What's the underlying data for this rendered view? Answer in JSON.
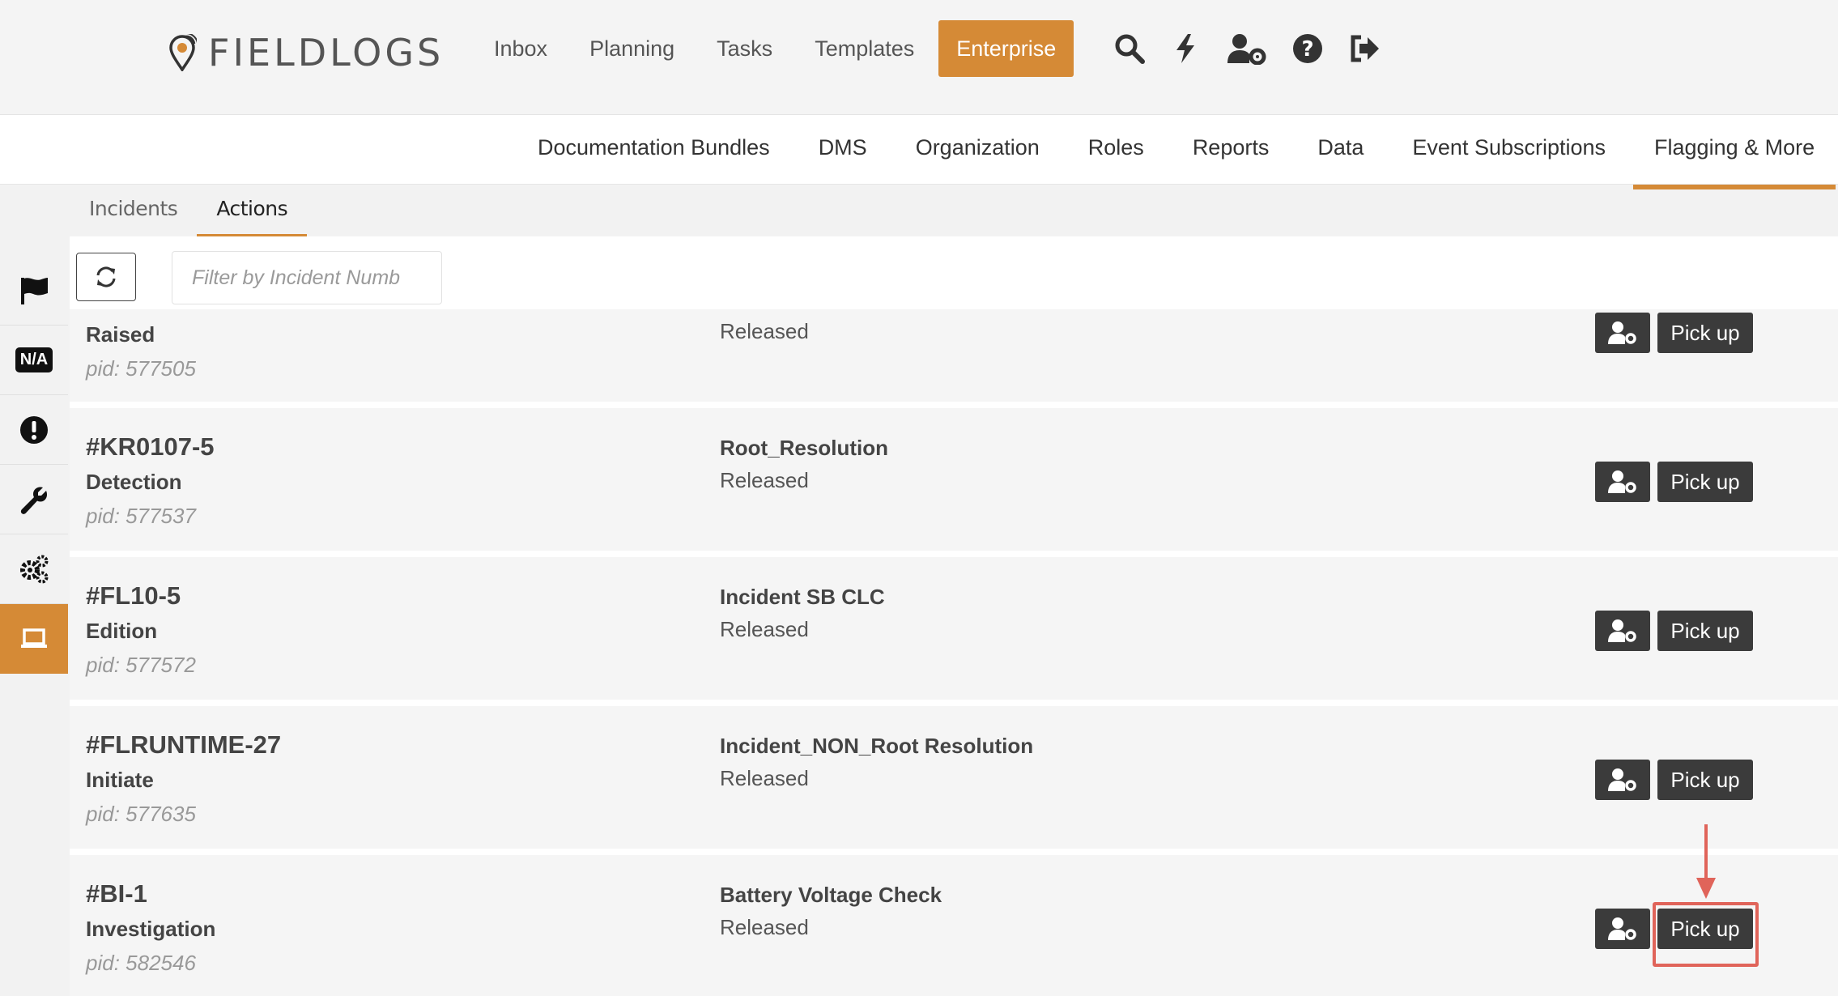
{
  "header": {
    "logo_text": "FIELDLOGS",
    "nav": [
      "Inbox",
      "Planning",
      "Tasks",
      "Templates"
    ],
    "active_nav": "Enterprise",
    "icons": [
      "search-icon",
      "bolt-icon",
      "user-settings-icon",
      "help-icon",
      "logout-icon"
    ],
    "accent_color": "#d58a36"
  },
  "subnav": {
    "items": [
      "Documentation Bundles",
      "DMS",
      "Organization",
      "Roles",
      "Reports",
      "Data",
      "Event Subscriptions"
    ],
    "active": "Flagging & More"
  },
  "tabs": {
    "incidents": "Incidents",
    "actions": "Actions"
  },
  "sidebar": {
    "items": [
      "flag-icon",
      "na-icon",
      "exclamation-icon",
      "wrench-icon",
      "gears-icon",
      "laptop-icon"
    ],
    "na_label": "N/A"
  },
  "toolbar": {
    "filter_placeholder": "Filter by Incident Numb"
  },
  "rows": [
    {
      "number": "",
      "stage": "Raised",
      "pid": "pid: 577505",
      "title": "",
      "status": "Released",
      "pick_label": "Pick up"
    },
    {
      "number": "#KR0107-5",
      "stage": "Detection",
      "pid": "pid: 577537",
      "title": "Root_Resolution",
      "status": "Released",
      "pick_label": "Pick up"
    },
    {
      "number": "#FL10-5",
      "stage": "Edition",
      "pid": "pid: 577572",
      "title": "Incident SB CLC",
      "status": "Released",
      "pick_label": "Pick up"
    },
    {
      "number": "#FLRUNTIME-27",
      "stage": "Initiate",
      "pid": "pid: 577635",
      "title": "Incident_NON_Root Resolution",
      "status": "Released",
      "pick_label": "Pick up"
    },
    {
      "number": "#BI-1",
      "stage": "Investigation",
      "pid": "pid: 582546",
      "title": "Battery Voltage Check",
      "status": "Released",
      "pick_label": "Pick up"
    }
  ]
}
